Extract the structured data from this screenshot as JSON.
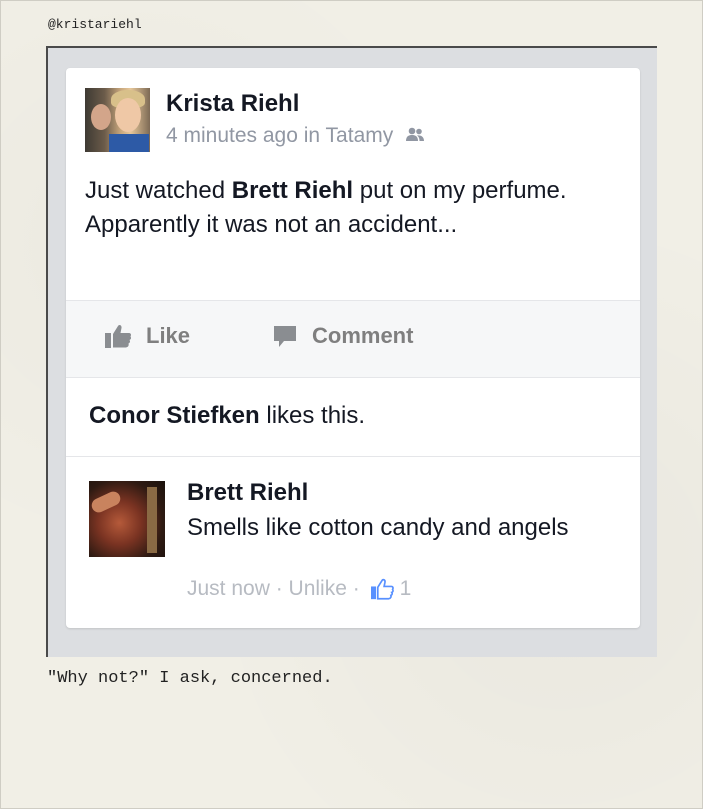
{
  "handle": "@kristariehl",
  "caption": "\"Why not?\" I ask, concerned.",
  "post": {
    "author": "Krista Riehl",
    "time": "4 minutes ago in Tatamy",
    "text_before": "Just watched ",
    "mention": "Brett Riehl",
    "text_after": " put on my perfume. Apparently it was not an accident..."
  },
  "actions": {
    "like_label": "Like",
    "comment_label": "Comment"
  },
  "likes": {
    "name": "Conor Stiefken",
    "suffix": " likes this."
  },
  "comment": {
    "author": "Brett Riehl",
    "text": "Smells like cotton candy and angels",
    "time": "Just now",
    "sep": " · ",
    "unlike_label": "Unlike",
    "like_count": "1"
  },
  "colors": {
    "primary_text": "#141823",
    "meta_text": "#9197a3",
    "action_text": "#7f7f7f",
    "like_blue": "#5890ff",
    "frame_bg": "#dcdee1"
  },
  "icons": [
    "friends-icon",
    "thumbs-up-icon",
    "comment-icon",
    "thumbs-up-blue-icon"
  ]
}
